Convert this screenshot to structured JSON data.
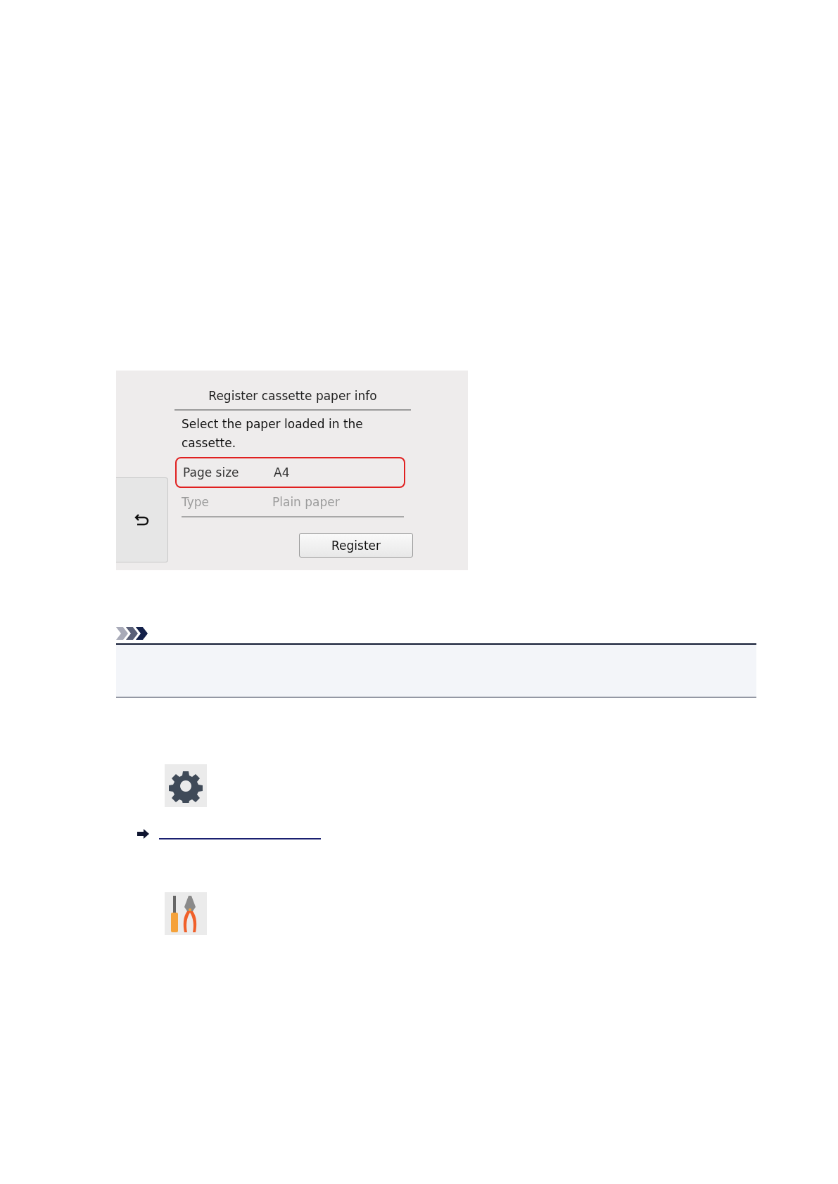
{
  "screen": {
    "title": "Register cassette paper info",
    "message": "Select the paper loaded in the cassette.",
    "rows": [
      {
        "label": "Page size",
        "value": "A4",
        "highlighted": true,
        "disabled": false
      },
      {
        "label": "Type",
        "value": "Plain paper",
        "highlighted": false,
        "disabled": true
      }
    ],
    "register_button": "Register"
  }
}
